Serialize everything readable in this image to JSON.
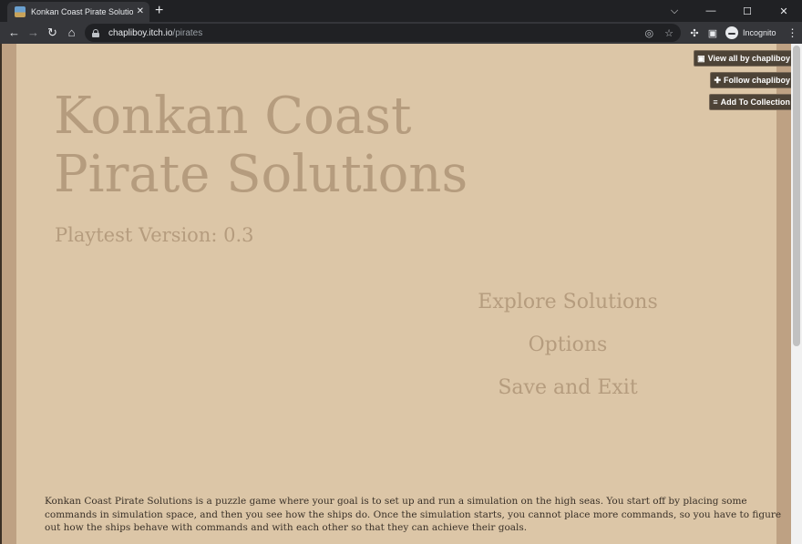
{
  "browser": {
    "tab_title": "Konkan Coast Pirate Solutions (p…",
    "tab_close": "✕",
    "new_tab": "+",
    "window_controls": [
      "⌵",
      "—",
      "☐",
      "✕"
    ],
    "nav": {
      "back": "←",
      "forward": "→",
      "reload": "↻",
      "home": "⌂"
    },
    "url_host": "chapliboy.itch.io",
    "url_path": "/pirates",
    "omnibox_icons": {
      "eye_off": "◎",
      "star": "☆"
    },
    "toolbar_icons": {
      "extensions": "✣",
      "sidebar": "▣"
    },
    "profile_label": "Incognito",
    "menu": "⋮"
  },
  "itch_buttons": [
    {
      "icon": "▣",
      "label": "View all by chapliboy"
    },
    {
      "icon": "✚",
      "label": "Follow chapliboy"
    },
    {
      "icon": "≡",
      "label": "Add To Collection"
    }
  ],
  "game": {
    "title_line1": "Konkan Coast",
    "title_line2": "Pirate Solutions",
    "version": "Playtest Version: 0.3",
    "menu": [
      "Explore Solutions",
      "Options",
      "Save and Exit"
    ]
  },
  "description": "Konkan Coast Pirate Solutions is a puzzle game where your goal is to set up and run a simulation on the high seas. You start off by placing some commands in simulation space, and then you see how the ships do. Once the simulation starts, you cannot place more commands, so you have to figure out how the ships behave with commands and with each other so that they can achieve their goals.",
  "colors": {
    "game_bg": "#dcc6a7",
    "game_text": "#b59c7e",
    "page_bg": "#bea183",
    "itch_button_bg": "#4d4337"
  }
}
